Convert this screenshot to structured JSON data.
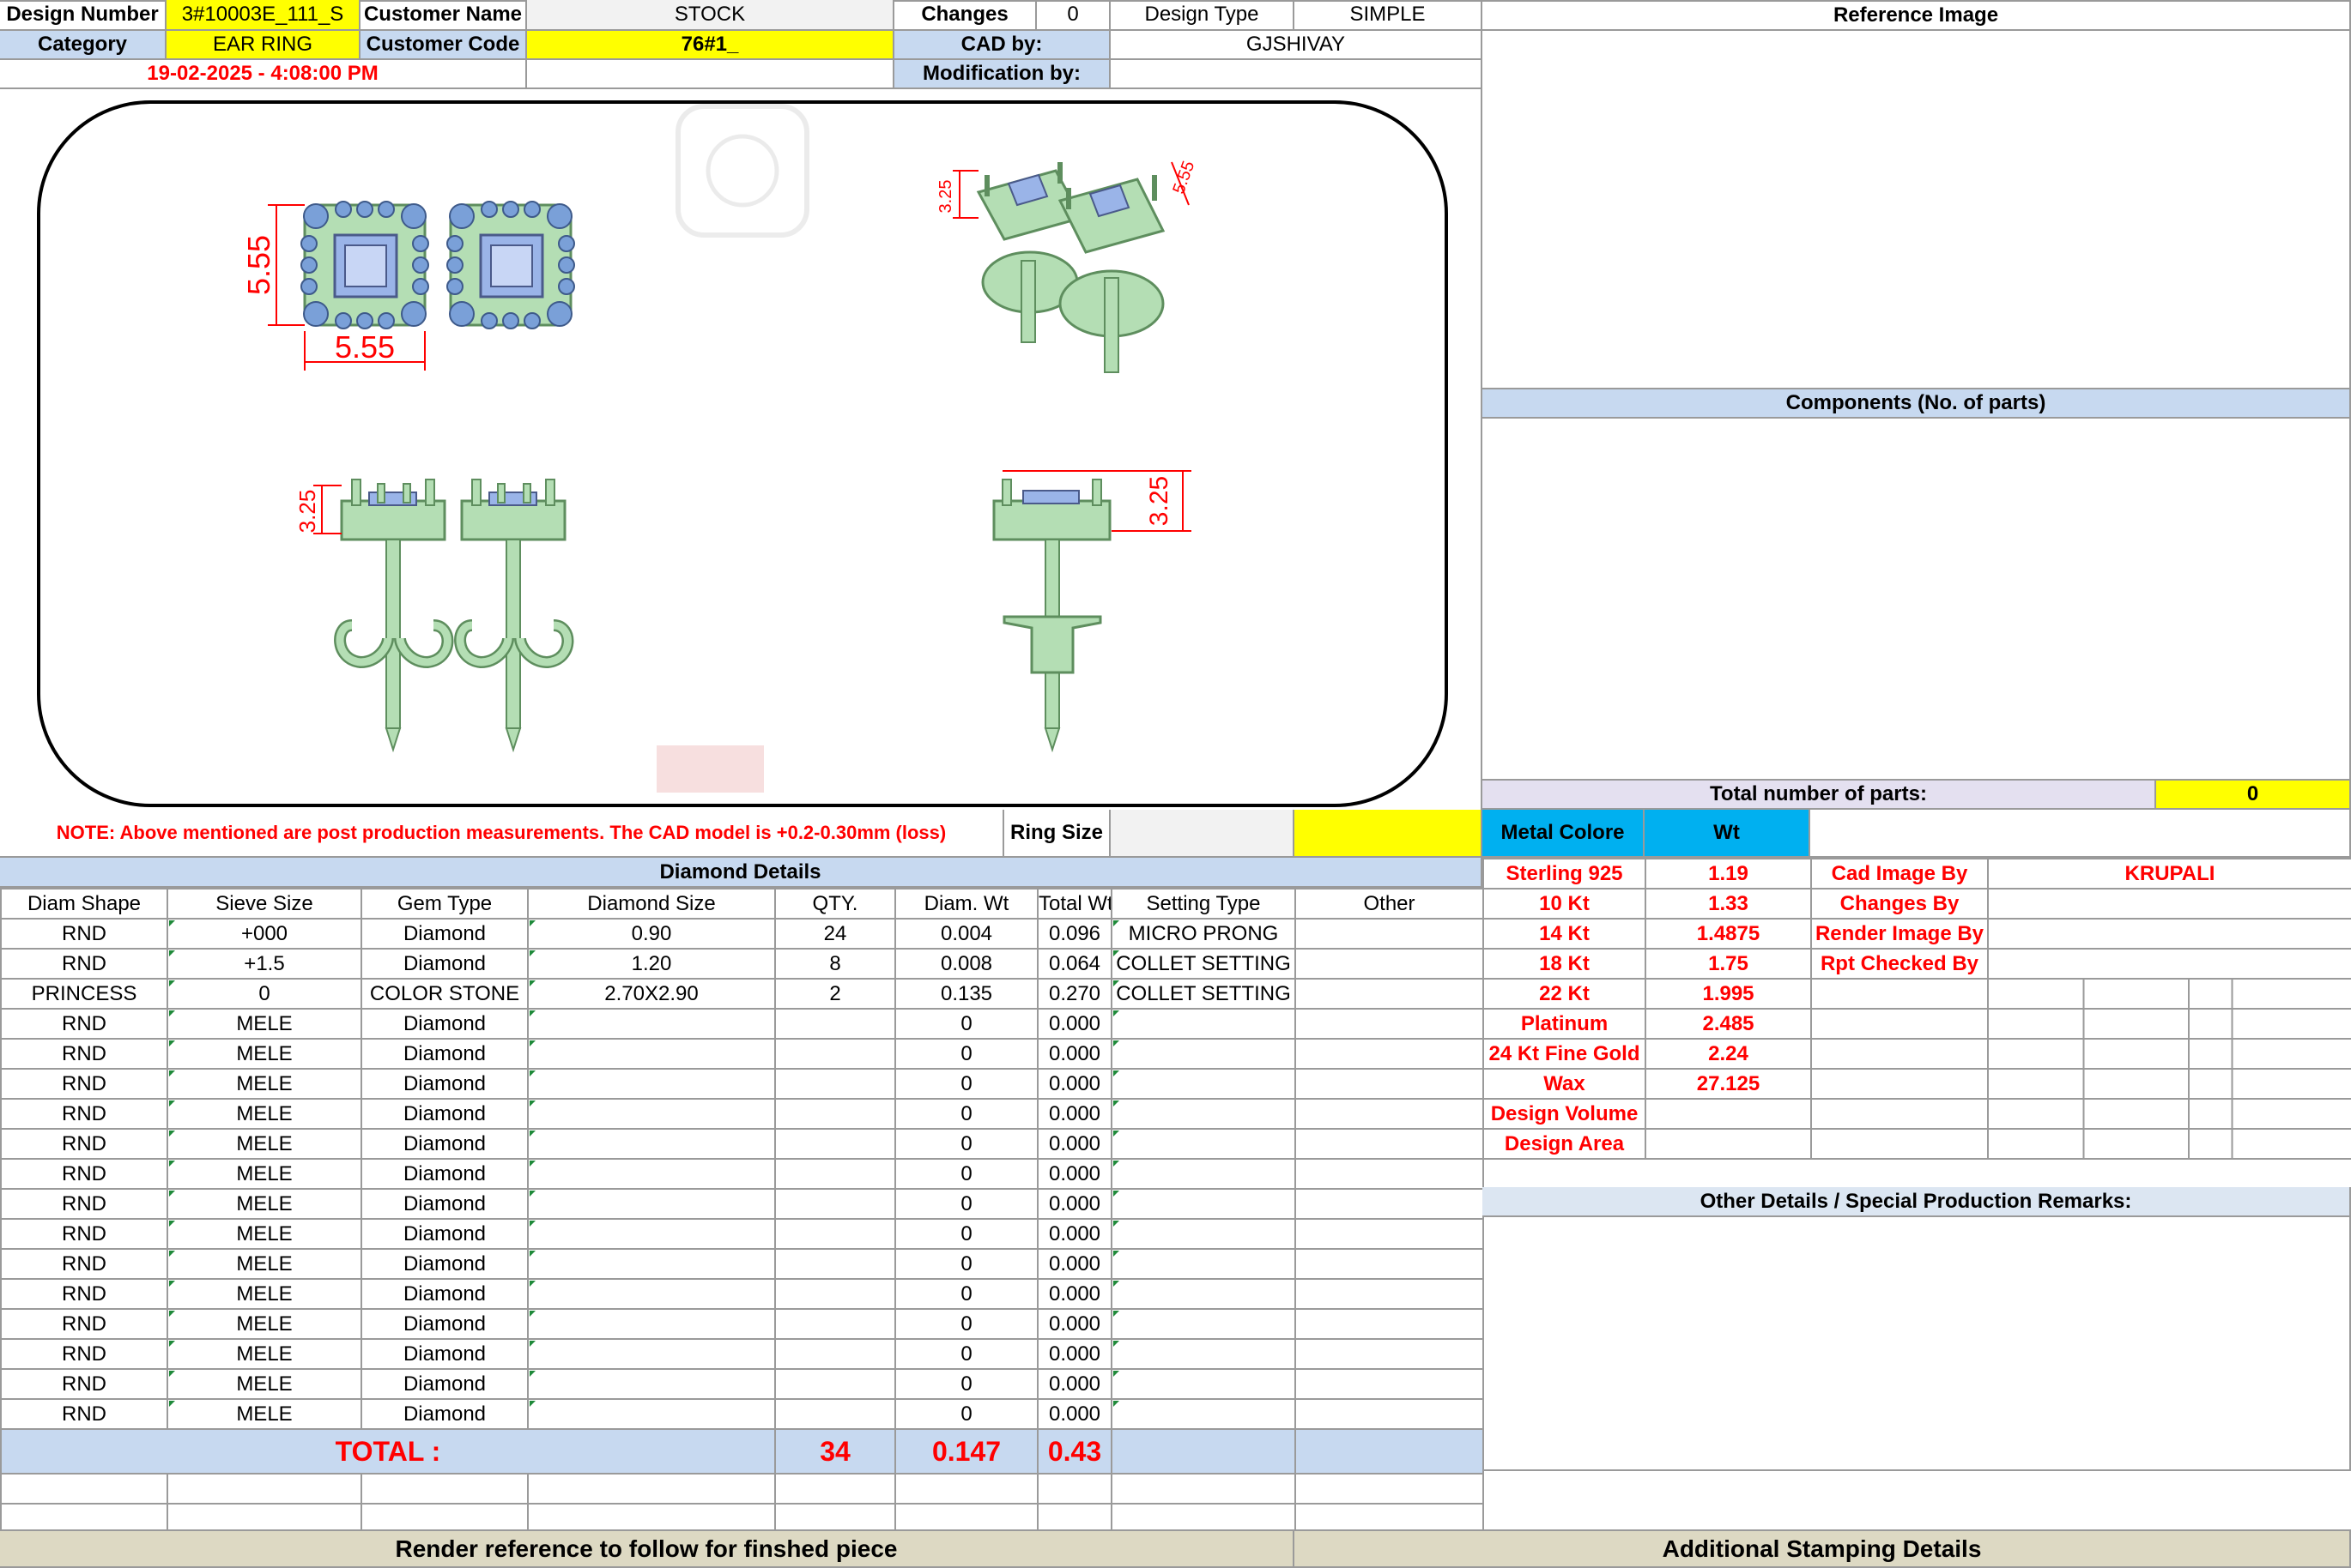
{
  "header": {
    "design_number_label": "Design Number",
    "design_number": "3#10003E_111_S",
    "customer_name_label": "Customer Name",
    "customer_name": "STOCK",
    "changes_label": "Changes",
    "changes": "0",
    "design_type_label": "Design Type",
    "design_type": "SIMPLE",
    "category_label": "Category",
    "category": "EAR RING",
    "customer_code_label": "Customer Code",
    "customer_code": "76#1_",
    "cad_by_label": "CAD by:",
    "cad_by": "GJSHIVAY",
    "timestamp": "19-02-2025 - 4:08:00 PM",
    "modification_by_label": "Modification by:",
    "modification_by": ""
  },
  "drawing": {
    "dim_width": "5.55",
    "dim_height": "5.55",
    "dim_side_left": "3.25",
    "dim_side_right": "3.25",
    "dim_iso_a": "3.25",
    "dim_iso_b": "5.55",
    "colors": {
      "metal": "#b4deb4",
      "metal_dark": "#5e8e5e",
      "stone": "#9ab4e8",
      "dim": "#ff0000"
    }
  },
  "reference_image_label": "Reference Image",
  "components_label": "Components (No. of parts)",
  "total_parts_label": "Total number of parts:",
  "total_parts": "0",
  "note": "NOTE: Above mentioned are post production measurements. The CAD model is +0.2-0.30mm (loss)",
  "ring_size_label": "Ring Size",
  "ring_size": "",
  "diamond_details_label": "Diamond Details",
  "diamond_columns": [
    "Diam Shape",
    "Sieve Size",
    "Gem Type",
    "Diamond Size",
    "QTY.",
    "Diam. Wt",
    "Total Wt",
    "Setting Type",
    "Other"
  ],
  "diamond_rows": [
    [
      "RND",
      "+000",
      "Diamond",
      "0.90",
      "24",
      "0.004",
      "0.096",
      "MICRO PRONG",
      ""
    ],
    [
      "RND",
      "+1.5",
      "Diamond",
      "1.20",
      "8",
      "0.008",
      "0.064",
      "COLLET SETTING",
      ""
    ],
    [
      "PRINCESS",
      "0",
      "COLOR STONE",
      "2.70X2.90",
      "2",
      "0.135",
      "0.270",
      "COLLET SETTING",
      ""
    ],
    [
      "RND",
      "MELE",
      "Diamond",
      "",
      "",
      "0",
      "0.000",
      "",
      ""
    ],
    [
      "RND",
      "MELE",
      "Diamond",
      "",
      "",
      "0",
      "0.000",
      "",
      ""
    ],
    [
      "RND",
      "MELE",
      "Diamond",
      "",
      "",
      "0",
      "0.000",
      "",
      ""
    ],
    [
      "RND",
      "MELE",
      "Diamond",
      "",
      "",
      "0",
      "0.000",
      "",
      ""
    ],
    [
      "RND",
      "MELE",
      "Diamond",
      "",
      "",
      "0",
      "0.000",
      "",
      ""
    ],
    [
      "RND",
      "MELE",
      "Diamond",
      "",
      "",
      "0",
      "0.000",
      "",
      ""
    ],
    [
      "RND",
      "MELE",
      "Diamond",
      "",
      "",
      "0",
      "0.000",
      "",
      ""
    ],
    [
      "RND",
      "MELE",
      "Diamond",
      "",
      "",
      "0",
      "0.000",
      "",
      ""
    ],
    [
      "RND",
      "MELE",
      "Diamond",
      "",
      "",
      "0",
      "0.000",
      "",
      ""
    ],
    [
      "RND",
      "MELE",
      "Diamond",
      "",
      "",
      "0",
      "0.000",
      "",
      ""
    ],
    [
      "RND",
      "MELE",
      "Diamond",
      "",
      "",
      "0",
      "0.000",
      "",
      ""
    ],
    [
      "RND",
      "MELE",
      "Diamond",
      "",
      "",
      "0",
      "0.000",
      "",
      ""
    ],
    [
      "RND",
      "MELE",
      "Diamond",
      "",
      "",
      "0",
      "0.000",
      "",
      ""
    ],
    [
      "RND",
      "MELE",
      "Diamond",
      "",
      "",
      "0",
      "0.000",
      "",
      ""
    ]
  ],
  "total": {
    "label": "TOTAL :",
    "qty": "34",
    "diam_wt": "0.147",
    "total_wt": "0.43"
  },
  "metal_colore_label": "Metal Colore",
  "wt_label": "Wt",
  "metals": [
    [
      "Sterling 925",
      "1.19"
    ],
    [
      "10 Kt",
      "1.33"
    ],
    [
      "14 Kt",
      "1.4875"
    ],
    [
      "18 Kt",
      "1.75"
    ],
    [
      "22 Kt",
      "1.995"
    ],
    [
      "Platinum",
      "2.485"
    ],
    [
      "24 Kt Fine Gold",
      "2.24"
    ],
    [
      "Wax",
      "27.125"
    ],
    [
      "Design Volume",
      ""
    ],
    [
      "Design Area",
      ""
    ]
  ],
  "credits": [
    [
      "Cad Image By",
      "KRUPALI"
    ],
    [
      "Changes By",
      ""
    ],
    [
      "Render Image By",
      ""
    ],
    [
      "Rpt Checked By",
      ""
    ]
  ],
  "other_details_label": "Other Details / Special Production Remarks:",
  "render_reference_label": "Render reference to follow for finshed piece",
  "stamping_label": "Additional Stamping Details"
}
